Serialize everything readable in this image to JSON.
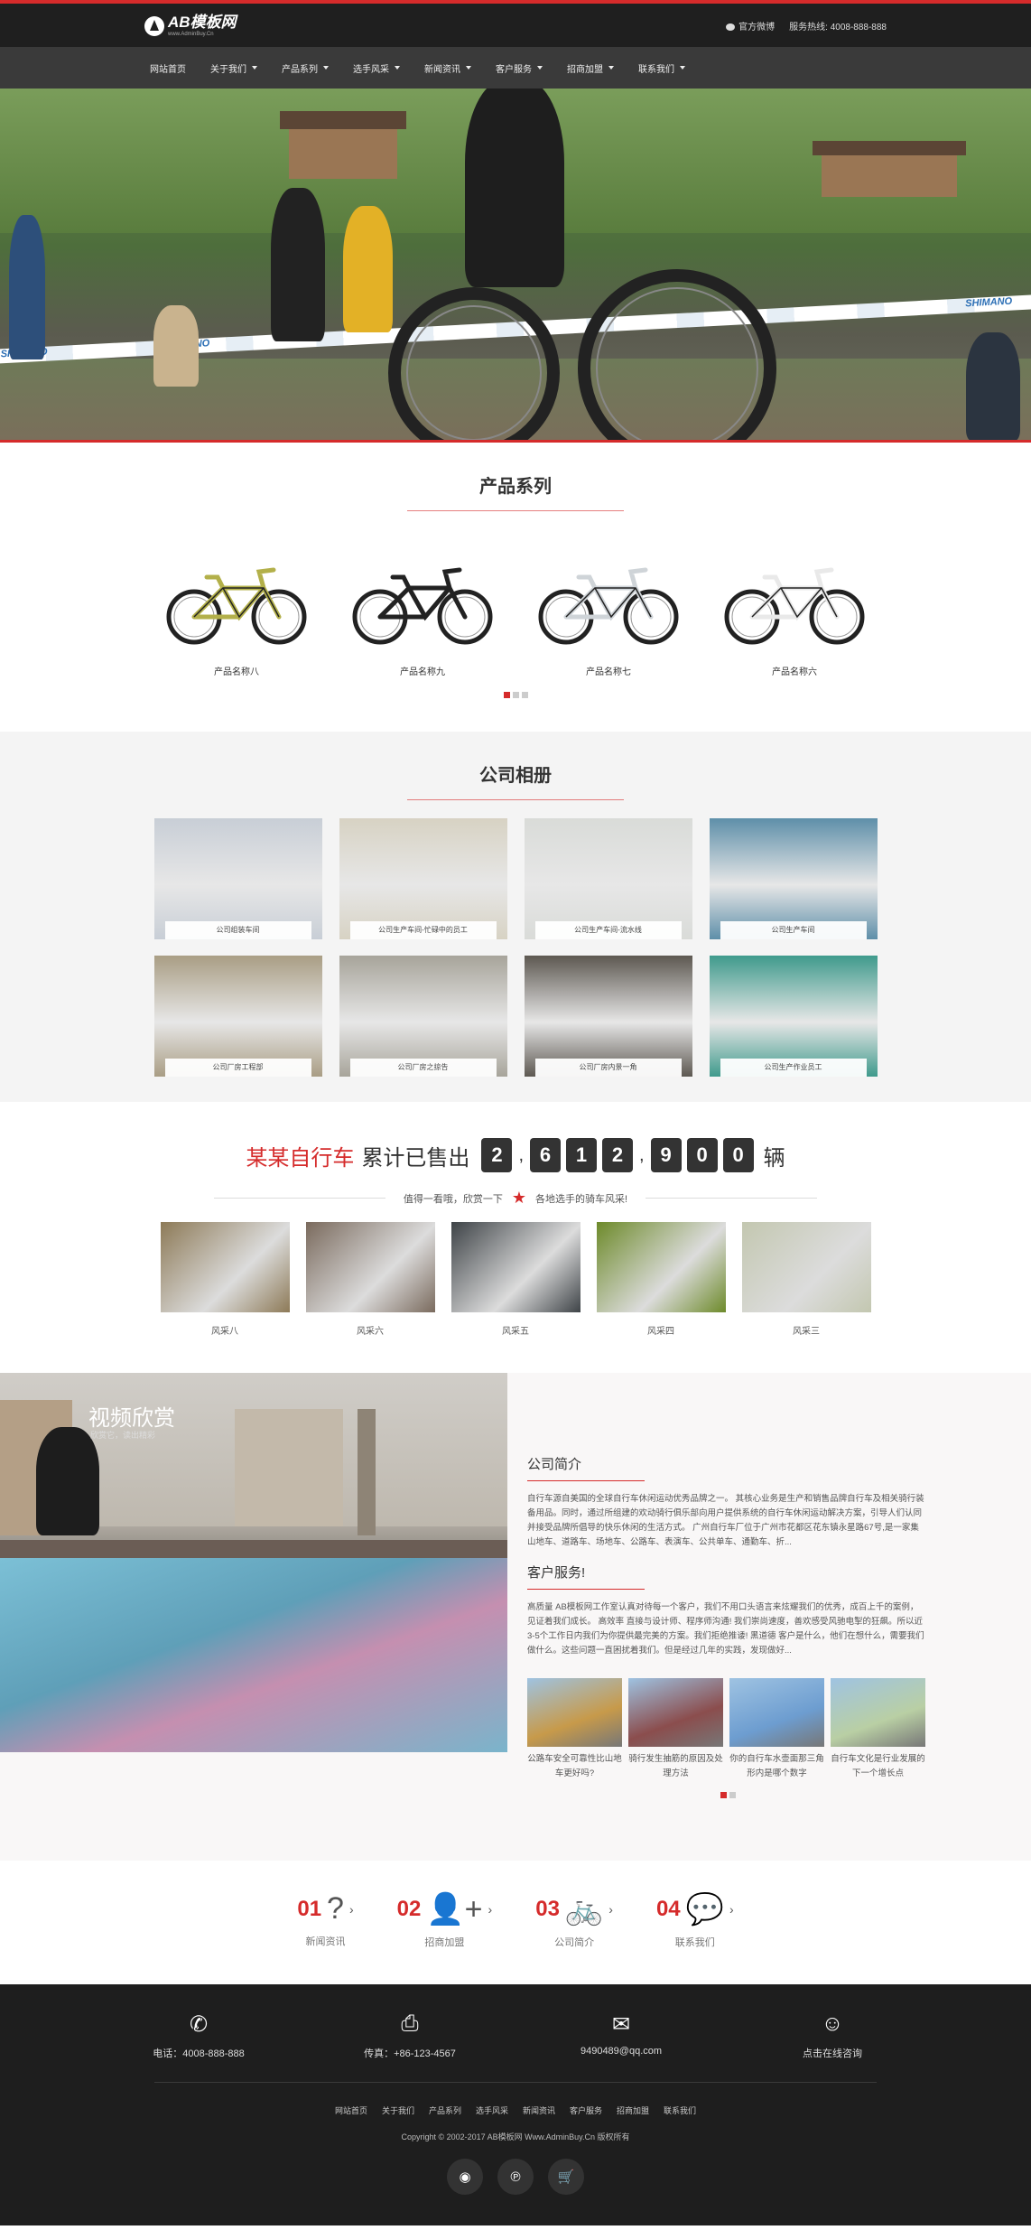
{
  "header": {
    "logo_name": "AB模板网",
    "logo_sub": "www.AdminBuy.Cn",
    "weibo_label": "官方微博",
    "hotline": "服务热线: 4008-888-888"
  },
  "nav": [
    {
      "label": "网站首页",
      "has_dropdown": false
    },
    {
      "label": "关于我们",
      "has_dropdown": true
    },
    {
      "label": "产品系列",
      "has_dropdown": true
    },
    {
      "label": "选手风采",
      "has_dropdown": true
    },
    {
      "label": "新闻资讯",
      "has_dropdown": true
    },
    {
      "label": "客户服务",
      "has_dropdown": true
    },
    {
      "label": "招商加盟",
      "has_dropdown": true
    },
    {
      "label": "联系我们",
      "has_dropdown": true
    }
  ],
  "hero": {
    "tape_text": "SHIMANO"
  },
  "products": {
    "title": "产品系列",
    "items": [
      {
        "name": "产品名称八",
        "color": "#b3b04a"
      },
      {
        "name": "产品名称九",
        "color": "#222222"
      },
      {
        "name": "产品名称七",
        "color": "#cfd4d8"
      },
      {
        "name": "产品名称六",
        "color": "#e9e9e9"
      }
    ]
  },
  "album": {
    "title": "公司相册",
    "items": [
      {
        "caption": "公司组装车间",
        "bg": "#c8ced6"
      },
      {
        "caption": "公司生产车间-忙碌中的员工",
        "bg": "#d7d2c3"
      },
      {
        "caption": "公司生产车间-流水线",
        "bg": "#d9dbd8"
      },
      {
        "caption": "公司生产车间",
        "bg": "#5e8fa9"
      },
      {
        "caption": "公司厂房工程部",
        "bg": "#a99d84"
      },
      {
        "caption": "公司厂房之掠告",
        "bg": "#a7a49a"
      },
      {
        "caption": "公司厂房内景一角",
        "bg": "#5d5851"
      },
      {
        "caption": "公司生产作业员工",
        "bg": "#3f9a8c"
      }
    ]
  },
  "stats": {
    "brand": "某某自行车",
    "label": "累计已售出",
    "digits": [
      "2",
      "6",
      "1",
      "2",
      "9",
      "0",
      "0"
    ],
    "unit": "辆",
    "subline_left": "值得一看哦，欣赏一下",
    "subline_right": "各地选手的骑车风采!",
    "items": [
      {
        "label": "风采八",
        "bg": "#8d7a57"
      },
      {
        "label": "风采六",
        "bg": "#7a6a5d"
      },
      {
        "label": "风采五",
        "bg": "#3e4347"
      },
      {
        "label": "风采四",
        "bg": "#6d8a2a"
      },
      {
        "label": "风采三",
        "bg": "#c3c7b0"
      }
    ]
  },
  "video": {
    "title": "视频欣赏",
    "subtitle": "欣赏它，读出精彩"
  },
  "intro": {
    "about_title": "公司简介",
    "about_text": "自行车源自美国的全球自行车休闲运动优秀品牌之一。 其核心业务是生产和销售品牌自行车及相关骑行装备用品。同时，通过所组建的欢动骑行俱乐部向用户提供系统的自行车休闲运动解决方案，引导人们认同并接受品牌所倡导的快乐休闲的生活方式。 广州自行车厂位于广州市花都区花东镇永星路67号,是一家集山地车、道路车、场地车、公路车、表演车、公共单车、通勤车、折...",
    "service_title": "客户服务!",
    "service_text": "高质量 AB模板网工作室认真对待每一个客户，我们不用口头语言来炫耀我们的优秀，成百上千的案例，见证着我们成长。 高效率 直接与设计师、程序师沟通! 我们崇尚速度，善欢感受风驰电掣的狂飙。所以近3-5个工作日内我们为你提供最完美的方案。我们拒绝推诿! 黑道德 客户是什么，他们在想什么，需要我们做什么。这些问题一直困扰着我们。但是经过几年的实践，发现做好...",
    "news": [
      {
        "title": "公路车安全可靠性比山地车更好吗?",
        "bg": "#c79a4a"
      },
      {
        "title": "骑行发生抽筋的原因及处理方法",
        "bg": "#8b4d4d"
      },
      {
        "title": "你的自行车水壶面那三角形内是哪个数字",
        "bg": "#6d9dd0"
      },
      {
        "title": "自行车文化是行业发展的下一个增长点",
        "bg": "#b9cfa4"
      }
    ]
  },
  "quick": [
    {
      "num": "01",
      "icon": "question-icon",
      "glyph": "?",
      "label": "新闻资讯"
    },
    {
      "num": "02",
      "icon": "add-user-icon",
      "glyph": "👤+",
      "label": "招商加盟"
    },
    {
      "num": "03",
      "icon": "bicycle-icon",
      "glyph": "🚲",
      "label": "公司简介"
    },
    {
      "num": "04",
      "icon": "chat-icon",
      "glyph": "💬",
      "label": "联系我们"
    }
  ],
  "footer": {
    "contacts": [
      {
        "icon": "phone-icon",
        "glyph": "✆",
        "text": "电话：4008-888-888"
      },
      {
        "icon": "printer-icon",
        "glyph": "⎙",
        "text": "传真：+86-123-4567"
      },
      {
        "icon": "mail-icon",
        "glyph": "✉",
        "text": "9490489@qq.com"
      },
      {
        "icon": "qq-icon",
        "glyph": "☺",
        "text": "点击在线咨询"
      }
    ],
    "links": [
      "网站首页",
      "关于我们",
      "产品系列",
      "选手风采",
      "新闻资讯",
      "客户服务",
      "招商加盟",
      "联系我们"
    ],
    "copyright": "Copyright © 2002-2017 AB模板网 Www.AdminBuy.Cn 版权所有",
    "social": [
      {
        "icon": "weibo-icon",
        "glyph": "◉"
      },
      {
        "icon": "pinterest-icon",
        "glyph": "℗"
      },
      {
        "icon": "cart-icon",
        "glyph": "🛒"
      }
    ]
  },
  "colors": {
    "accent": "#d52b2b",
    "dark": "#1f1f1f",
    "nav": "#3a3a3a"
  }
}
